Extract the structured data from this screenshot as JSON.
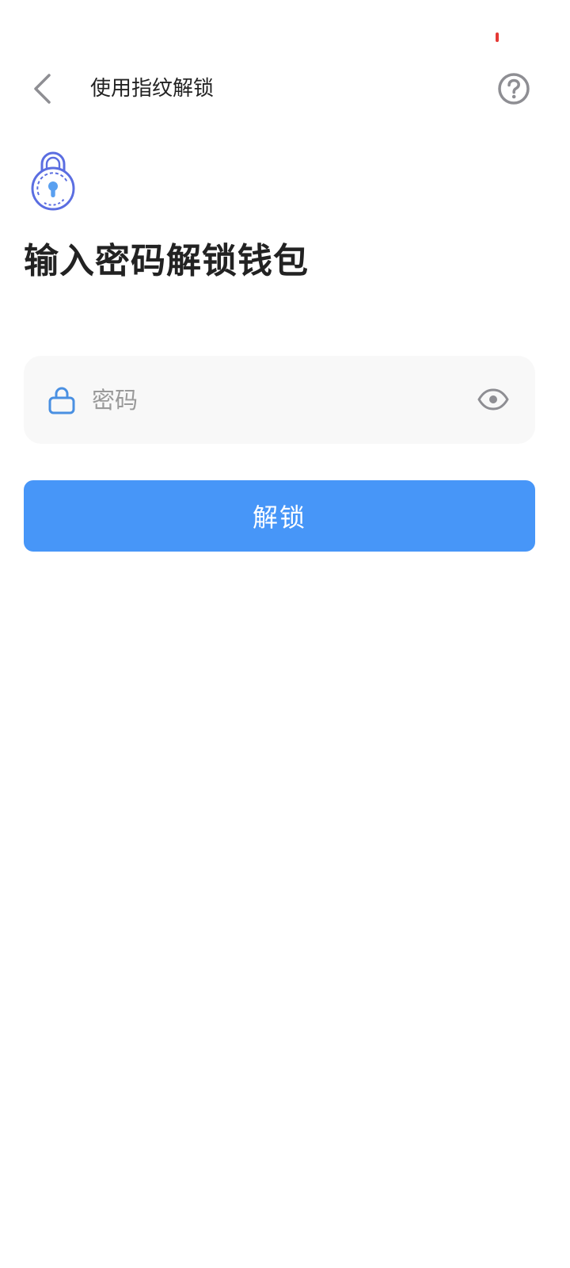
{
  "status_bar": {
    "indicator_color": "#e53935"
  },
  "header": {
    "back_icon": "chevron-left-icon",
    "fingerprint_link": "使用指纹解锁",
    "help_icon": "question-circle-icon"
  },
  "main": {
    "hero_icon": "padlock-keyhole-icon",
    "title": "输入密码解锁钱包",
    "password_field": {
      "value": "",
      "placeholder": "密码",
      "leading_icon": "lock-icon",
      "trailing_icon": "eye-icon"
    },
    "unlock_button": {
      "label": "解锁"
    }
  },
  "colors": {
    "accent": "#4796f8",
    "icon_blue": "#4a90e2",
    "hero_icon_outline": "#5b6ee1",
    "text_primary": "#222222",
    "placeholder": "#9a9a9a",
    "icon_gray": "#8e8e93",
    "field_background": "#f8f8f8"
  }
}
